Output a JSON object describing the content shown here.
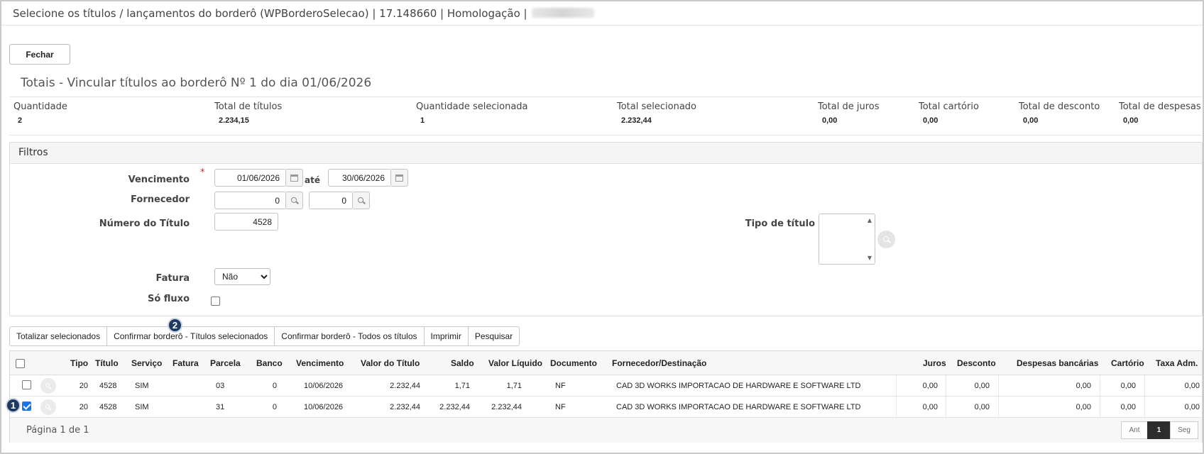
{
  "window": {
    "title": "Selecione os títulos / lançamentos do borderô (WPBorderoSelecao) | 17.148660 | Homologação |"
  },
  "actions": {
    "fechar": "Fechar"
  },
  "totais": {
    "title": "Totais - Vincular títulos ao borderô Nº 1 do dia 01/06/2026",
    "items": [
      {
        "label": "Quantidade",
        "value": "2"
      },
      {
        "label": "Total de títulos",
        "value": "2.234,15"
      },
      {
        "label": "Quantidade selecionada",
        "value": "1"
      },
      {
        "label": "Total selecionado",
        "value": "2.232,44"
      },
      {
        "label": "Total de juros",
        "value": "0,00"
      },
      {
        "label": "Total cartório",
        "value": "0,00"
      },
      {
        "label": "Total de desconto",
        "value": "0,00"
      },
      {
        "label": "Total de despesas",
        "value": "0,00"
      }
    ]
  },
  "filtros": {
    "title": "Filtros",
    "vencimento": {
      "label": "Vencimento",
      "required": "*",
      "from": "01/06/2026",
      "ate": "até",
      "to": "30/06/2026"
    },
    "fornecedor": {
      "label": "Fornecedor",
      "from": "0",
      "to": "0"
    },
    "numero_titulo": {
      "label": "Número do Título",
      "value": "4528"
    },
    "tipo_titulo": {
      "label": "Tipo de título"
    },
    "fatura": {
      "label": "Fatura",
      "selected": "Não"
    },
    "so_fluxo": {
      "label": "Só fluxo",
      "checked": false
    }
  },
  "toolbar": {
    "totalizar": "Totalizar selecionados",
    "confirmar_sel": "Confirmar borderô - Títulos selecionados",
    "confirmar_todos": "Confirmar borderô - Todos os títulos",
    "imprimir": "Imprimir",
    "pesquisar": "Pesquisar"
  },
  "badges": {
    "one": "1",
    "two": "2"
  },
  "grid": {
    "headers": {
      "tipo": "Tipo",
      "titulo": "Título",
      "servico": "Serviço",
      "fatura": "Fatura",
      "parcela": "Parcela",
      "banco": "Banco",
      "vencimento": "Vencimento",
      "valor_titulo": "Valor do Título",
      "saldo": "Saldo",
      "valor_liquido": "Valor Líquido",
      "documento": "Documento",
      "fornecedor": "Fornecedor/Destinação",
      "juros": "Juros",
      "desconto": "Desconto",
      "despesas": "Despesas bancárias",
      "cartorio": "Cartório",
      "taxa": "Taxa Adm."
    },
    "rows": [
      {
        "checked": false,
        "tipo": "20",
        "titulo": "4528",
        "servico": "SIM",
        "fatura": "",
        "parcela": "03",
        "banco": "0",
        "vencimento": "10/06/2026",
        "valor_titulo": "2.232,44",
        "saldo": "1,71",
        "valor_liquido": "1,71",
        "documento": "NF",
        "fornecedor": "CAD 3D WORKS IMPORTACAO DE HARDWARE E SOFTWARE LTD",
        "juros": "0,00",
        "desconto": "0,00",
        "despesas": "0,00",
        "cartorio": "0,00",
        "taxa": "0,00"
      },
      {
        "checked": true,
        "tipo": "20",
        "titulo": "4528",
        "servico": "SIM",
        "fatura": "",
        "parcela": "31",
        "banco": "0",
        "vencimento": "10/06/2026",
        "valor_titulo": "2.232,44",
        "saldo": "2.232,44",
        "valor_liquido": "2.232,44",
        "documento": "NF",
        "fornecedor": "CAD 3D WORKS IMPORTACAO DE HARDWARE E SOFTWARE LTD",
        "juros": "0,00",
        "desconto": "0,00",
        "despesas": "0,00",
        "cartorio": "0,00",
        "taxa": "0,00"
      }
    ],
    "pagination": {
      "label": "Página 1 de 1",
      "prev": "Ant",
      "current": "1",
      "next": "Seg"
    }
  },
  "colors": {
    "accent": "#1a73e8",
    "badge": "#1e3a62",
    "required": "#d9232d"
  }
}
